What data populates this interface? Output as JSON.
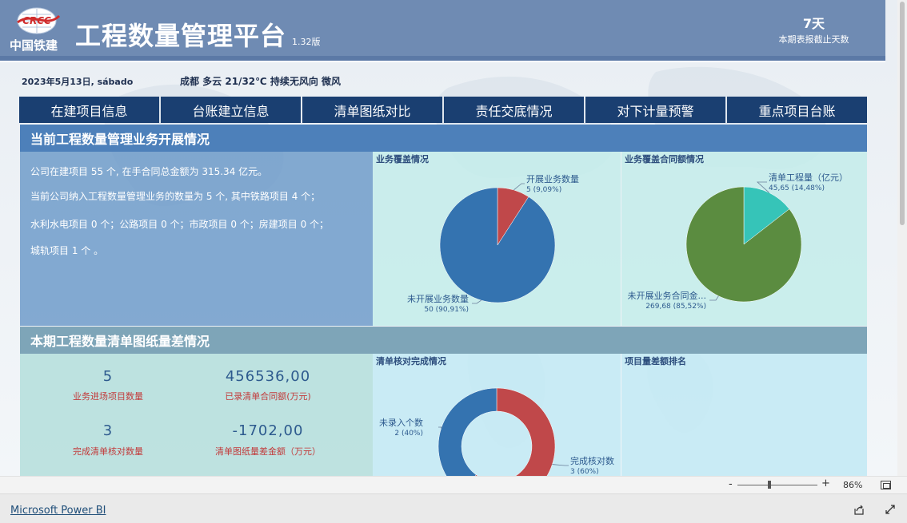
{
  "header": {
    "logo_mark": "CRCC",
    "logo_text": "中国铁建",
    "title": "工程数量管理平台",
    "version": "1.32版",
    "deadline_value": "7天",
    "deadline_label": "本期表报截止天数"
  },
  "infobar": {
    "date": "2023年5月13日, sábado",
    "weather": "成都  多云   21/32℃   持续无风向 微风"
  },
  "nav": {
    "items": [
      "在建项目信息",
      "台账建立信息",
      "清单图纸对比",
      "责任交底情况",
      "对下计量预警",
      "重点项目台账"
    ]
  },
  "section1": {
    "title": "当前工程数量管理业务开展情况",
    "lines": [
      "公司在建项目 55 个, 在手合同总金额为 315.34 亿元。",
      "当前公司纳入工程数量管理业务的数量为 5 个, 其中铁路项目 4 个；",
      "水利水电项目 0 个；公路项目 0 个；市政项目 0 个；房建项目 0 个；",
      "城轨项目 1 个 。"
    ],
    "chart1_title": "业务覆盖情况",
    "chart2_title": "业务覆盖合同额情况"
  },
  "section2": {
    "title": "本期工程数量清单图纸量差情况",
    "kpis": [
      {
        "value": "5",
        "label": "业务进场项目数量"
      },
      {
        "value": "456536,00",
        "label": "已录清单合同额(万元)"
      },
      {
        "value": "3",
        "label": "完成清单核对数量"
      },
      {
        "value": "-1702,00",
        "label": "清单图纸量差金额（万元）"
      }
    ],
    "chart3_title": "清单核对完成情况",
    "chart4_title": "项目量差额排名"
  },
  "chart_data": [
    {
      "type": "pie",
      "title": "业务覆盖情况",
      "slices": [
        {
          "label": "开展业务数量",
          "value": 5,
          "display": "5 (9,09%)",
          "color": "#c0484a"
        },
        {
          "label": "未开展业务数量",
          "value": 50,
          "display": "50 (90,91%)",
          "color": "#3473b0"
        }
      ]
    },
    {
      "type": "pie",
      "title": "业务覆盖合同额情况",
      "slices": [
        {
          "label": "清单工程量（亿元）",
          "value": 45.65,
          "display": "45,65 (14,48%)",
          "color": "#36c4b8"
        },
        {
          "label": "未开展业务合同金...",
          "value": 269.68,
          "display": "269,68 (85,52%)",
          "color": "#5b8c40"
        }
      ]
    },
    {
      "type": "pie",
      "title": "清单核对完成情况",
      "donut": true,
      "slices": [
        {
          "label": "完成核对数",
          "value": 3,
          "display": "3 (60%)",
          "color": "#c0484a"
        },
        {
          "label": "未录入个数",
          "value": 2,
          "display": "2 (40%)",
          "color": "#3473b0"
        }
      ]
    }
  ],
  "zoom": {
    "minus": "-",
    "plus": "+",
    "level": "86%",
    "level_value": 0.4
  },
  "footer": {
    "brand": "Microsoft Power BI"
  }
}
